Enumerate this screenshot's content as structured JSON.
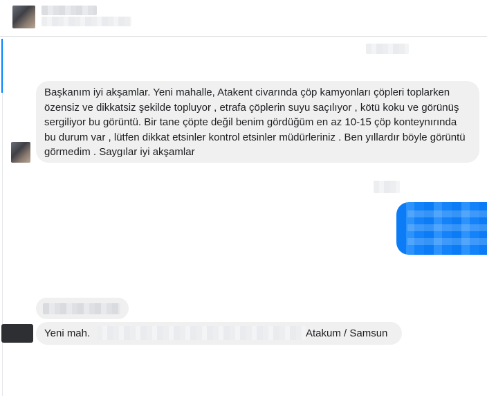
{
  "header": {},
  "messages": {
    "incoming_1": "Başkanım iyi akşamlar. Yeni mahalle, Atakent civarında çöp kamyonları çöpleri toplarken özensiz ve dikkatsiz şekilde topluyor , etrafa çöplerin suyu saçılıyor , kötü koku ve görünüş sergiliyor bu görüntü. Bir tane çöpte değil benim gördüğüm en az 10-15 çöp konteynırında bu durum var , lütfen dikkat etsinler kontrol etsinler müdürleriniz . Ben yıllardır böyle görüntü görmedim . Saygılar iyi akşamlar",
    "incoming_2_prefix": "Yeni mah.",
    "incoming_2_suffix": "Atakum / Samsun"
  },
  "colors": {
    "accent": "#0084ff",
    "incoming_bubble": "#f1f0f0",
    "outgoing_bubble": "#0084ff",
    "text": "#1c1e21"
  }
}
